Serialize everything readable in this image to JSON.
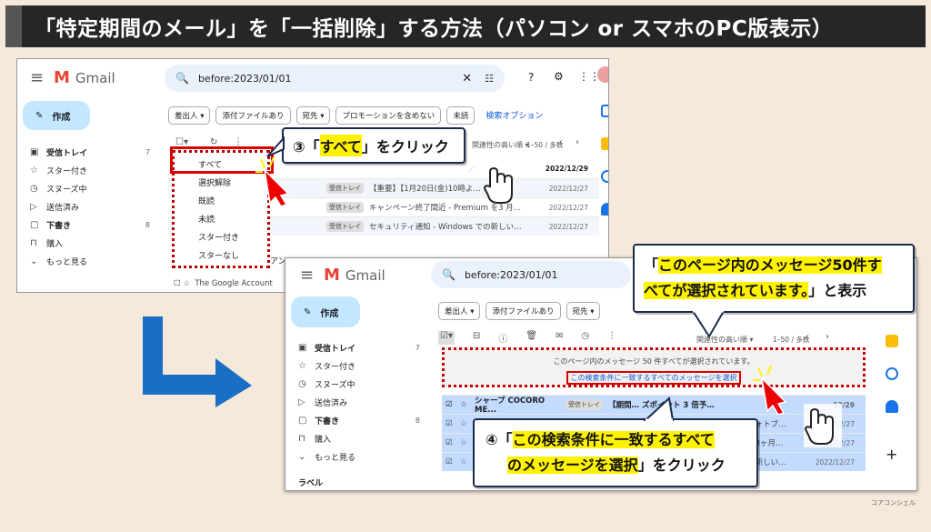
{
  "title": "「特定期間のメール」を「一括削除」する方法（パソコン or スマホのPC版表示）",
  "watermark": "コアコンシェル",
  "gmail": {
    "brand": "Gmail",
    "search_query": "before:2023/01/01",
    "compose": "作成"
  },
  "nav": [
    {
      "label": "受信トレイ",
      "count": "7",
      "icon": "inbox-icon"
    },
    {
      "label": "スター付き",
      "count": "",
      "icon": "star-icon"
    },
    {
      "label": "スヌーズ中",
      "count": "",
      "icon": "clock-icon"
    },
    {
      "label": "送信済み",
      "count": "",
      "icon": "send-icon"
    },
    {
      "label": "下書き",
      "count": "8",
      "icon": "draft-icon"
    },
    {
      "label": "購入",
      "count": "",
      "icon": "bag-icon"
    },
    {
      "label": "もっと見る",
      "count": "",
      "icon": "chevron-down-icon"
    }
  ],
  "nav2_more": "ラベル",
  "filters": [
    "差出人 ▾",
    "添付ファイルあり",
    "宛先 ▾",
    "プロモーションを含めない",
    "未読"
  ],
  "filters2": [
    "差出人 ▾",
    "添付ファイルあり",
    "宛先 ▾"
  ],
  "adv_search": "検索オプション",
  "select_menu": [
    "すべて",
    "選択解除",
    "既読",
    "未読",
    "スター付き",
    "スターなし"
  ],
  "shot1": {
    "sort": "関連性の高い順",
    "pagination": "1–50 / 多数",
    "rows": [
      {
        "label": "",
        "subject": "",
        "date": "2022/12/29"
      },
      {
        "label": "受信トレイ",
        "subject": "【重要】【1月20日(金)10時よ… ／ ブ…",
        "date": "2022/12/27"
      },
      {
        "label": "受信トレイ",
        "subject": "キャンペーン終了間近 - Premium を3 月…",
        "date": "2022/12/27"
      },
      {
        "label": "受信トレイ",
        "subject": "セキュリティ通知 - Windows での新しい…",
        "date": "2022/12/27"
      }
    ],
    "last_row_fragment": "アン",
    "sender_last": "The Google Account"
  },
  "shot2": {
    "sort": "関連性の高い順",
    "pagination": "1–50 / 多数",
    "banner_text": "このページ内のメッセージ 50 件すべてが選択されています。",
    "banner_link": "この検索条件に一致するすべてのメッセージを選択",
    "rows": [
      {
        "sender": "シャープ COCORO ME...",
        "label": "受信トレイ",
        "subject": "【期間… ズポイント 3 倍予…",
        "date": "12/29"
      },
      {
        "sender": "",
        "label": "",
        "subject": "…フォトブ…",
        "date": "22/12/27"
      },
      {
        "sender": "",
        "label": "",
        "subject": "…を3ヶ月…",
        "date": "22/12/27"
      },
      {
        "sender": "",
        "label": "",
        "subject": "…い新しい…",
        "date": "2022/12/27"
      }
    ]
  },
  "callout1": {
    "num": "③「",
    "hl": "すべて",
    "tail": "」をクリック"
  },
  "callout2": {
    "l1_pre": "「",
    "l1_hl": "このページ内のメッセージ50件す",
    "l2_hl": "べてが選択されています。",
    "l2_tail": "」と表示"
  },
  "callout3": {
    "l1_pre": "④「",
    "l1_hl": "この検索条件に一致するすべて",
    "l2_hl": "のメッセージを選択",
    "l2_tail": "」をクリック"
  },
  "colors": {
    "red": "#d00000",
    "blue": "#1a6fc4",
    "highlight": "#fff200"
  }
}
